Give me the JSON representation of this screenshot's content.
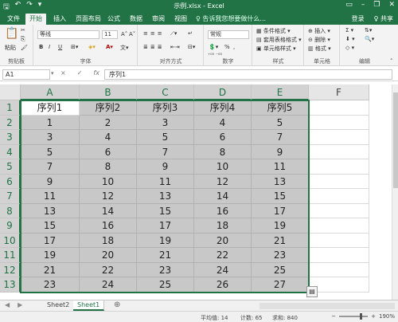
{
  "titlebar": {
    "title": "示例.xlsx - Excel",
    "qat_icons": [
      "save-icon",
      "undo-icon",
      "redo-icon"
    ],
    "window_controls": [
      "ribbon-display-icon",
      "minimize-icon",
      "restore-icon",
      "close-icon"
    ]
  },
  "ribbon_tabs": [
    {
      "label": "文件",
      "active": false
    },
    {
      "label": "开始",
      "active": true
    },
    {
      "label": "插入",
      "active": false
    },
    {
      "label": "页面布局",
      "active": false
    },
    {
      "label": "公式",
      "active": false
    },
    {
      "label": "数据",
      "active": false
    },
    {
      "label": "审阅",
      "active": false
    },
    {
      "label": "视图",
      "active": false
    }
  ],
  "tell_me": "♀ 告诉我您想要做什么...",
  "account": {
    "login": "登录",
    "share": "♀ 共享"
  },
  "ribbon": {
    "clipboard": {
      "paste": "粘贴",
      "group": "剪贴板"
    },
    "font": {
      "name": "等线",
      "size": "11",
      "bold": "B",
      "italic": "I",
      "underline": "U",
      "group": "字体"
    },
    "alignment": {
      "group": "对齐方式"
    },
    "number": {
      "format": "常规",
      "percent": "%",
      "comma": ",",
      "group": "数字"
    },
    "styles": {
      "conditional": "条件格式",
      "table": "套用表格格式",
      "cell": "单元格样式",
      "group": "样式"
    },
    "cells": {
      "insert": "插入",
      "delete": "删除",
      "format": "格式",
      "group": "单元格"
    },
    "editing": {
      "group": "编辑"
    }
  },
  "formula_bar": {
    "name_box": "A1",
    "cancel": "×",
    "enter": "✓",
    "fx": "fx",
    "content": "序列1"
  },
  "grid": {
    "columns": [
      "A",
      "B",
      "C",
      "D",
      "E",
      "F"
    ],
    "rows": [
      "1",
      "2",
      "3",
      "4",
      "5",
      "6",
      "7",
      "8",
      "9",
      "10",
      "11",
      "12",
      "13"
    ],
    "data": [
      [
        "序列1",
        "序列2",
        "序列3",
        "序列4",
        "序列5"
      ],
      [
        "1",
        "2",
        "3",
        "4",
        "5"
      ],
      [
        "3",
        "4",
        "5",
        "6",
        "7"
      ],
      [
        "5",
        "6",
        "7",
        "8",
        "9"
      ],
      [
        "7",
        "8",
        "9",
        "10",
        "11"
      ],
      [
        "9",
        "10",
        "11",
        "12",
        "13"
      ],
      [
        "11",
        "12",
        "13",
        "14",
        "15"
      ],
      [
        "13",
        "14",
        "15",
        "16",
        "17"
      ],
      [
        "15",
        "16",
        "17",
        "18",
        "19"
      ],
      [
        "17",
        "18",
        "19",
        "20",
        "21"
      ],
      [
        "19",
        "20",
        "21",
        "22",
        "23"
      ],
      [
        "21",
        "22",
        "23",
        "24",
        "25"
      ],
      [
        "23",
        "24",
        "25",
        "26",
        "27"
      ]
    ],
    "active_cell": "A1",
    "selection": "A1:E13",
    "accent_color": "#217346"
  },
  "sheets": [
    {
      "label": "Sheet2",
      "active": false
    },
    {
      "label": "Sheet1",
      "active": true
    }
  ],
  "status": {
    "average": "平均值: 14",
    "count": "计数: 65",
    "sum": "求和: 840",
    "zoom": "190%"
  }
}
